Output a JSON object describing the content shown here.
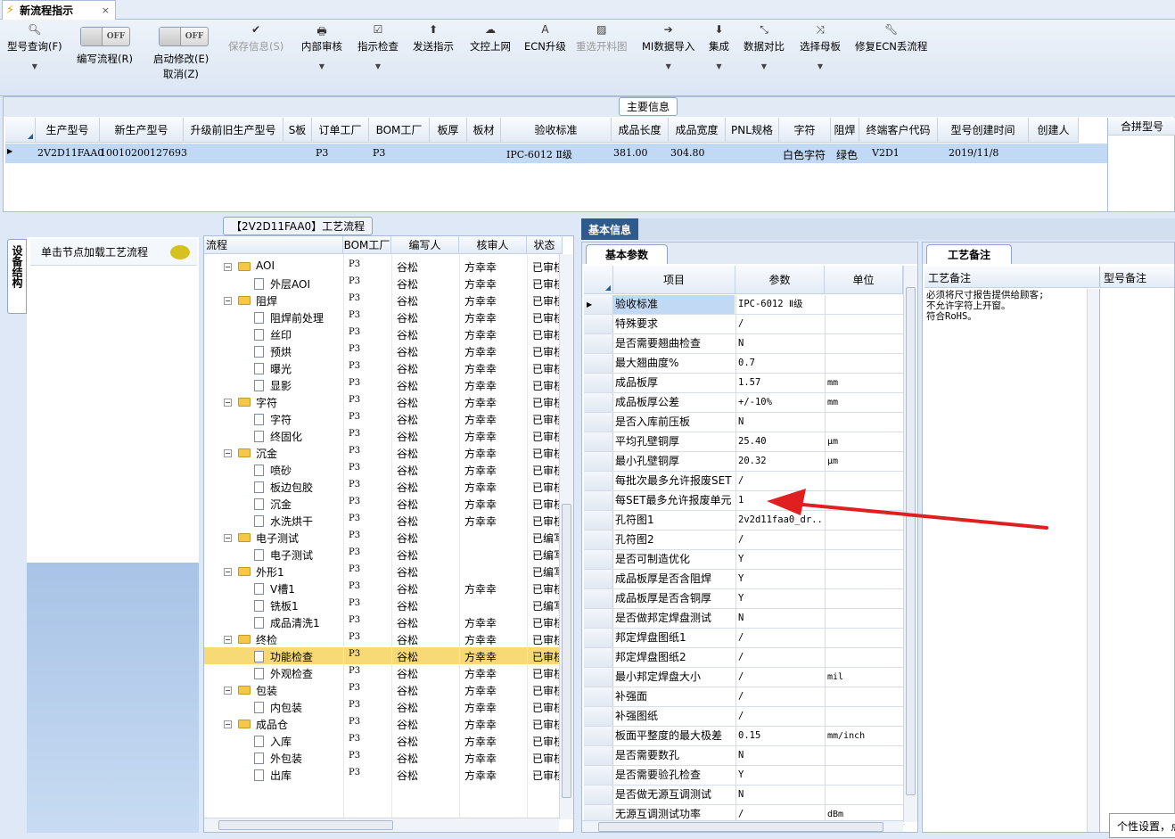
{
  "tab": {
    "title": "新流程指示",
    "close": "×"
  },
  "toolbar": {
    "query": "型号查询(F)",
    "edit_flow": "编写流程(R)",
    "start_modify": "启动修改(E)",
    "cancel": "取消(Z)",
    "toggle_off": "OFF",
    "save": "保存信息(S)",
    "internal_review": "内部审核",
    "check": "指示检查",
    "send": "发送指示",
    "upload": "文控上网",
    "ecn_up": "ECN升级",
    "reselect": "重选开料图",
    "mi_import": "MI数据导入",
    "integrate": "集成",
    "compare": "数据对比",
    "select_master": "选择母板",
    "repair_ecn": "修复ECN丢流程"
  },
  "main_info": {
    "title": "主要信息",
    "headers": [
      "生产型号",
      "新生产型号",
      "升级前旧生产型号",
      "S板",
      "订单工厂",
      "BOM工厂",
      "板厚",
      "板材",
      "验收标准",
      "成品长度",
      "成品宽度",
      "PNL规格",
      "字符",
      "阻焊",
      "终端客户代码",
      "型号创建时间",
      "创建人"
    ],
    "row": [
      "2V2D11FAA0",
      "10010200127693",
      "",
      "",
      "P3",
      "P3",
      "",
      "",
      "IPC-6012 Ⅱ级",
      "381.00",
      "304.80",
      "",
      "白色字符",
      "绿色",
      "V2D1",
      "2019/11/8",
      ""
    ],
    "merge_header": "合拼型号"
  },
  "left": {
    "vertical_tab": "设备结构",
    "load_hint": "单击节点加载工艺流程"
  },
  "flow": {
    "title": "【2V2D11FAA0】工艺流程",
    "headers": [
      "流程",
      "BOM工厂",
      "编写人",
      "核审人",
      "状态"
    ],
    "rows": [
      {
        "name": "AOI",
        "type": "folder",
        "bom": "P3",
        "writer": "谷松",
        "reviewer": "方幸幸",
        "status": "已审核"
      },
      {
        "name": "外层AOI",
        "type": "leaf",
        "bom": "P3",
        "writer": "谷松",
        "reviewer": "方幸幸",
        "status": "已审核"
      },
      {
        "name": "阻焊",
        "type": "folder",
        "bom": "P3",
        "writer": "谷松",
        "reviewer": "方幸幸",
        "status": "已审核"
      },
      {
        "name": "阻焊前处理",
        "type": "leaf",
        "bom": "P3",
        "writer": "谷松",
        "reviewer": "方幸幸",
        "status": "已审核"
      },
      {
        "name": "丝印",
        "type": "leaf",
        "bom": "P3",
        "writer": "谷松",
        "reviewer": "方幸幸",
        "status": "已审核"
      },
      {
        "name": "预烘",
        "type": "leaf",
        "bom": "P3",
        "writer": "谷松",
        "reviewer": "方幸幸",
        "status": "已审核"
      },
      {
        "name": "曝光",
        "type": "leaf",
        "bom": "P3",
        "writer": "谷松",
        "reviewer": "方幸幸",
        "status": "已审核"
      },
      {
        "name": "显影",
        "type": "leaf",
        "bom": "P3",
        "writer": "谷松",
        "reviewer": "方幸幸",
        "status": "已审核"
      },
      {
        "name": "字符",
        "type": "folder",
        "bom": "P3",
        "writer": "谷松",
        "reviewer": "方幸幸",
        "status": "已审核"
      },
      {
        "name": "字符",
        "type": "leaf",
        "bom": "P3",
        "writer": "谷松",
        "reviewer": "方幸幸",
        "status": "已审核"
      },
      {
        "name": "终固化",
        "type": "leaf",
        "bom": "P3",
        "writer": "谷松",
        "reviewer": "方幸幸",
        "status": "已审核"
      },
      {
        "name": "沉金",
        "type": "folder",
        "bom": "P3",
        "writer": "谷松",
        "reviewer": "方幸幸",
        "status": "已审核"
      },
      {
        "name": "喷砂",
        "type": "leaf",
        "bom": "P3",
        "writer": "谷松",
        "reviewer": "方幸幸",
        "status": "已审核"
      },
      {
        "name": "板边包胶",
        "type": "leaf",
        "bom": "P3",
        "writer": "谷松",
        "reviewer": "方幸幸",
        "status": "已审核"
      },
      {
        "name": "沉金",
        "type": "leaf",
        "bom": "P3",
        "writer": "谷松",
        "reviewer": "方幸幸",
        "status": "已审核"
      },
      {
        "name": "水洗烘干",
        "type": "leaf",
        "bom": "P3",
        "writer": "谷松",
        "reviewer": "方幸幸",
        "status": "已审核"
      },
      {
        "name": "电子测试",
        "type": "folder",
        "bom": "P3",
        "writer": "谷松",
        "reviewer": "",
        "status": "已编写"
      },
      {
        "name": "电子测试",
        "type": "leaf",
        "bom": "P3",
        "writer": "谷松",
        "reviewer": "",
        "status": "已编写"
      },
      {
        "name": "外形1",
        "type": "folder",
        "bom": "P3",
        "writer": "谷松",
        "reviewer": "",
        "status": "已编写"
      },
      {
        "name": "V槽1",
        "type": "leaf",
        "bom": "P3",
        "writer": "谷松",
        "reviewer": "方幸幸",
        "status": "已审核"
      },
      {
        "name": "铣板1",
        "type": "leaf",
        "bom": "P3",
        "writer": "谷松",
        "reviewer": "",
        "status": "已编写"
      },
      {
        "name": "成品清洗1",
        "type": "leaf",
        "bom": "P3",
        "writer": "谷松",
        "reviewer": "方幸幸",
        "status": "已审核"
      },
      {
        "name": "终检",
        "type": "folder",
        "bom": "P3",
        "writer": "谷松",
        "reviewer": "方幸幸",
        "status": "已审核"
      },
      {
        "name": "功能检查",
        "type": "leaf",
        "bom": "P3",
        "writer": "谷松",
        "reviewer": "方幸幸",
        "status": "已审核",
        "selected": true
      },
      {
        "name": "外观检查",
        "type": "leaf",
        "bom": "P3",
        "writer": "谷松",
        "reviewer": "方幸幸",
        "status": "已审核"
      },
      {
        "name": "包装",
        "type": "folder",
        "bom": "P3",
        "writer": "谷松",
        "reviewer": "方幸幸",
        "status": "已审核"
      },
      {
        "name": "内包装",
        "type": "leaf",
        "bom": "P3",
        "writer": "谷松",
        "reviewer": "方幸幸",
        "status": "已审核"
      },
      {
        "name": "成品仓",
        "type": "folder",
        "bom": "P3",
        "writer": "谷松",
        "reviewer": "方幸幸",
        "status": "已审核"
      },
      {
        "name": "入库",
        "type": "leaf",
        "bom": "P3",
        "writer": "谷松",
        "reviewer": "方幸幸",
        "status": "已审核"
      },
      {
        "name": "外包装",
        "type": "leaf",
        "bom": "P3",
        "writer": "谷松",
        "reviewer": "方幸幸",
        "status": "已审核"
      },
      {
        "name": "出库",
        "type": "leaf",
        "bom": "P3",
        "writer": "谷松",
        "reviewer": "方幸幸",
        "status": "已审核"
      }
    ]
  },
  "basic": {
    "tab": "基本信息",
    "subtab": "基本参数",
    "headers": [
      "项目",
      "参数",
      "单位"
    ],
    "rows": [
      {
        "name": "验收标准",
        "value": "IPC-6012 Ⅱ级",
        "unit": ""
      },
      {
        "name": "特殊要求",
        "value": "/",
        "unit": ""
      },
      {
        "name": "是否需要翘曲检查",
        "value": "N",
        "unit": ""
      },
      {
        "name": "最大翘曲度%",
        "value": "0.7",
        "unit": ""
      },
      {
        "name": "成品板厚",
        "value": "1.57",
        "unit": "mm"
      },
      {
        "name": "成品板厚公差",
        "value": "+/-10%",
        "unit": "mm"
      },
      {
        "name": "是否入库前压板",
        "value": "N",
        "unit": ""
      },
      {
        "name": "平均孔壁铜厚",
        "value": "25.40",
        "unit": "μm"
      },
      {
        "name": "最小孔壁铜厚",
        "value": "20.32",
        "unit": "μm"
      },
      {
        "name": "每批次最多允许报废SET",
        "value": "/",
        "unit": ""
      },
      {
        "name": "每SET最多允许报废单元",
        "value": "1",
        "unit": ""
      },
      {
        "name": "孔符图1",
        "value": "2v2d11faa0_dr...",
        "unit": ""
      },
      {
        "name": "孔符图2",
        "value": "/",
        "unit": ""
      },
      {
        "name": "是否可制造优化",
        "value": "Y",
        "unit": ""
      },
      {
        "name": "成品板厚是否含阻焊",
        "value": "Y",
        "unit": ""
      },
      {
        "name": "成品板厚是否含铜厚",
        "value": "Y",
        "unit": ""
      },
      {
        "name": "是否做邦定焊盘测试",
        "value": "N",
        "unit": ""
      },
      {
        "name": "邦定焊盘图纸1",
        "value": "/",
        "unit": ""
      },
      {
        "name": "邦定焊盘图纸2",
        "value": "/",
        "unit": ""
      },
      {
        "name": "最小邦定焊盘大小",
        "value": "/",
        "unit": "mil"
      },
      {
        "name": "补强面",
        "value": "/",
        "unit": ""
      },
      {
        "name": "补强图纸",
        "value": "/",
        "unit": ""
      },
      {
        "name": "板面平整度的最大极差",
        "value": "0.15",
        "unit": "mm/inch"
      },
      {
        "name": "是否需要数孔",
        "value": "N",
        "unit": ""
      },
      {
        "name": "是否需要验孔检查",
        "value": "Y",
        "unit": ""
      },
      {
        "name": "是否做无源互调测试",
        "value": "N",
        "unit": ""
      },
      {
        "name": "无源互调测试功率",
        "value": "/",
        "unit": "dBm"
      }
    ]
  },
  "notes": {
    "tab": "工艺备注",
    "col1": "工艺备注",
    "col2": "型号备注",
    "lines": [
      "必须将尺寸报告提供给顾客;",
      "不允许字符上开窗。",
      "符合RoHS。"
    ]
  },
  "status": {
    "tip": "个性设置，点"
  },
  "colors": {
    "accent": "#2f5a8c",
    "arrow": "#e02020",
    "selected": "#f7d976"
  }
}
